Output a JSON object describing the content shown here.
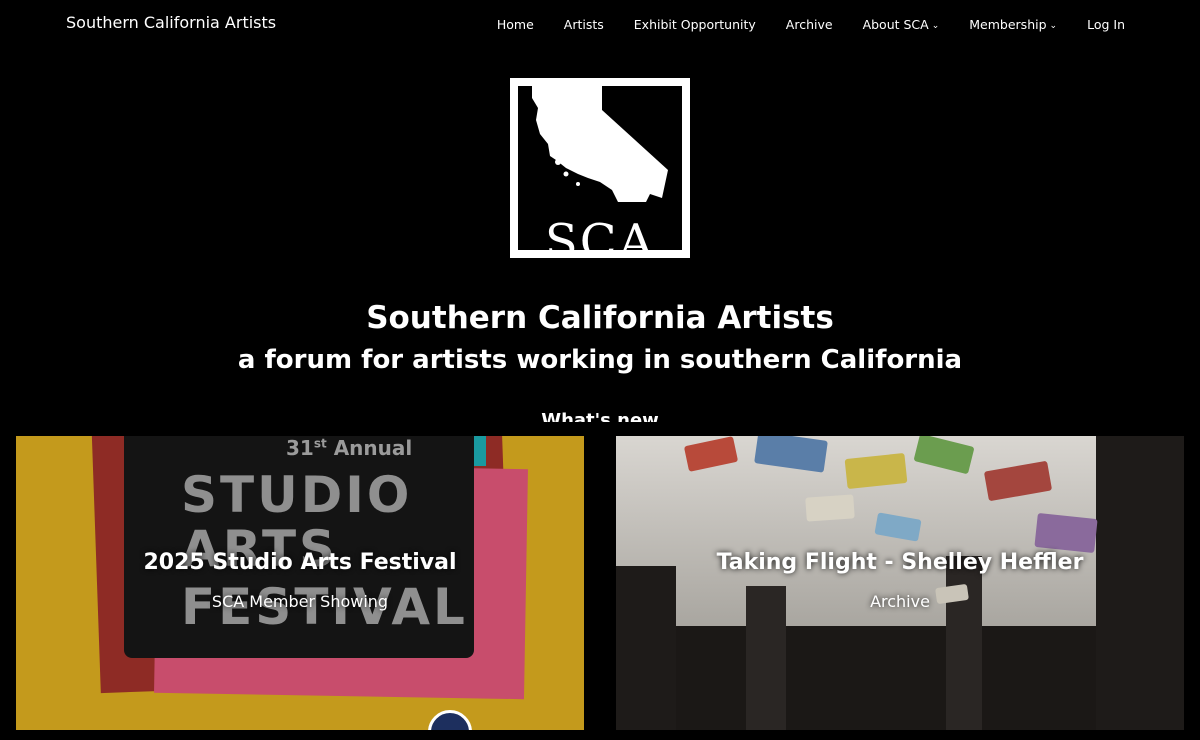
{
  "header": {
    "site_name": "Southern California Artists",
    "nav": [
      {
        "label": "Home",
        "dropdown": false
      },
      {
        "label": "Artists",
        "dropdown": false
      },
      {
        "label": "Exhibit Opportunity",
        "dropdown": false
      },
      {
        "label": "Archive",
        "dropdown": false
      },
      {
        "label": "About SCA",
        "dropdown": true
      },
      {
        "label": "Membership",
        "dropdown": true
      },
      {
        "label": "Log In",
        "dropdown": false
      }
    ],
    "chevron": "⌄"
  },
  "logo": {
    "text": "SCA"
  },
  "hero": {
    "title": "Southern California Artists",
    "subtitle": "a forum for artists working in southern California",
    "section_heading": "What's new"
  },
  "cards": [
    {
      "title": "2025 Studio Arts Festival",
      "category": "SCA Member Showing",
      "poster": {
        "annual_num": "31",
        "annual_sup": "st",
        "annual_word": "Annual",
        "line1": "STUDIO",
        "line2": "ARTS",
        "line3": "FESTIVAL"
      }
    },
    {
      "title": "Taking Flight - Shelley Heffler",
      "category": "Archive"
    }
  ],
  "colors": {
    "background": "#000000",
    "text": "#ffffff",
    "poster_mustard": "#c49a1c",
    "poster_red": "#8e2b25",
    "poster_pink": "#c84d6c"
  }
}
